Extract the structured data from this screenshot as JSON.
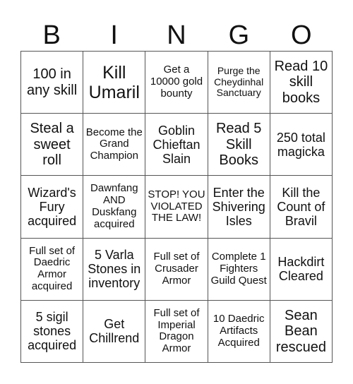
{
  "header": {
    "letters": [
      "B",
      "I",
      "N",
      "G",
      "O"
    ]
  },
  "cells": [
    "100 in any skill",
    "Kill Umaril",
    "Get a 10000 gold bounty",
    "Purge the Cheydinhal Sanctuary",
    "Read 10 skill books",
    "Steal a sweet roll",
    "Become the Grand Champion",
    "Goblin Chieftan Slain",
    "Read 5 Skill Books",
    "250 total magicka",
    "Wizard's Fury acquired",
    "Dawnfang AND Duskfang acquired",
    "STOP! YOU VIOLATED THE LAW!",
    "Enter the Shivering Isles",
    "Kill the Count of Bravil",
    "Full set of Daedric Armor acquired",
    "5 Varla Stones in inventory",
    "Full set of Crusader Armor",
    "Complete 1 Fighters Guild Quest",
    "Hackdirt Cleared",
    "5 sigil stones acquired",
    "Get Chillrend",
    "Full set of Imperial Dragon Armor",
    "10 Daedric Artifacts Acquired",
    "Sean Bean rescued"
  ]
}
